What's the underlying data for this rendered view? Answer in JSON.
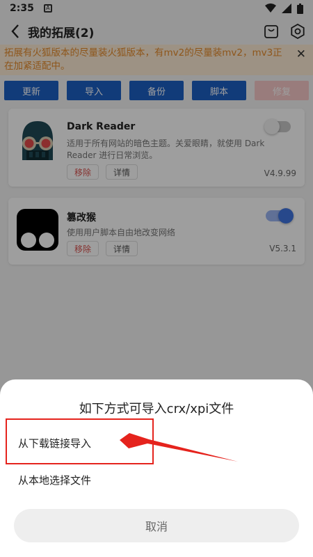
{
  "status_bar": {
    "time": "2:35"
  },
  "app_bar": {
    "title": "我的拓展(2)"
  },
  "notice": {
    "text": "拓展有火狐版本的尽量装火狐版本，有mv2的尽量装mv2，mv3正在加紧适配中。",
    "close": "✕"
  },
  "toolbar": {
    "buttons": [
      "更新",
      "导入",
      "备份",
      "脚本",
      "修复"
    ]
  },
  "extensions": [
    {
      "name": "Dark Reader",
      "description": "适用于所有网站的暗色主题。关爱眼睛，就使用 Dark Reader 进行日常浏览。",
      "remove": "移除",
      "detail": "详情",
      "version": "V4.9.99",
      "enabled": false
    },
    {
      "name": "篡改猴",
      "description": "使用用户脚本自由地改变网络",
      "remove": "移除",
      "detail": "详情",
      "version": "V5.3.1",
      "enabled": true
    }
  ],
  "sheet": {
    "title": "如下方式可导入crx/xpi文件",
    "options": [
      "从下载链接导入",
      "从本地选择文件"
    ],
    "cancel": "取消"
  },
  "colors": {
    "primary": "#1c5fc4",
    "notice_text": "#e68c2c",
    "annotation": "#e5231d"
  }
}
